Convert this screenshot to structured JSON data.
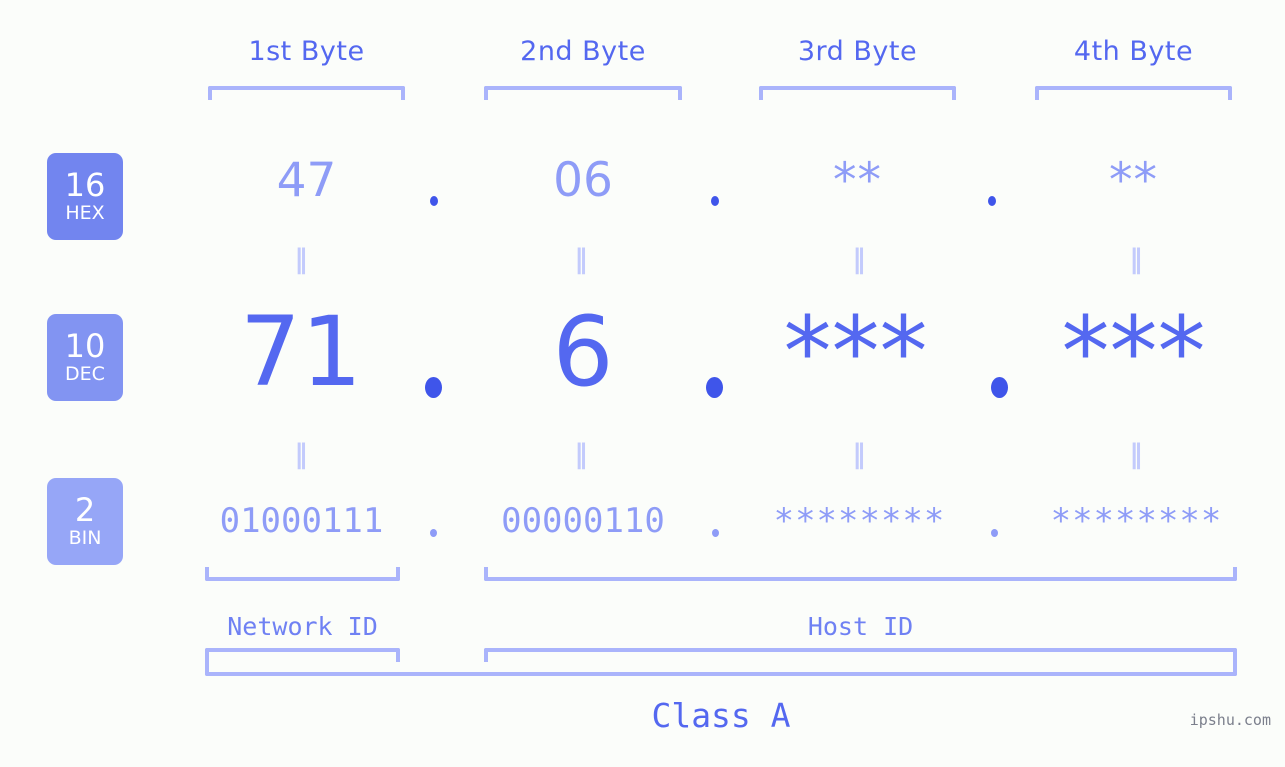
{
  "meta": {
    "background_color": "#fbfdfa",
    "accent_color": "#5468f0",
    "light_accent_color": "#aab4fb",
    "mid_accent_color": "#8e9cf7"
  },
  "byte_headers": [
    {
      "label": "1st Byte"
    },
    {
      "label": "2nd Byte"
    },
    {
      "label": "3rd Byte"
    },
    {
      "label": "4th Byte"
    }
  ],
  "radix_rows": [
    {
      "number": "16",
      "name": "HEX",
      "color": "#7285ef"
    },
    {
      "number": "10",
      "name": "DEC",
      "color": "#8294f2"
    },
    {
      "number": "2",
      "name": "BIN",
      "color": "#96a6f7"
    }
  ],
  "hex_row": {
    "values": [
      "47",
      "06",
      "**",
      "**"
    ],
    "separators": [
      ".",
      ".",
      "."
    ]
  },
  "dec_row": {
    "values": [
      "71",
      "6",
      "***",
      "***"
    ],
    "separators": [
      ".",
      ".",
      "."
    ]
  },
  "bin_row": {
    "values": [
      "01000111",
      "00000110",
      "********",
      "********"
    ],
    "separators": [
      ".",
      ".",
      "."
    ]
  },
  "equals_marks": {
    "symbol": "‖",
    "rows": 2,
    "columns": 4
  },
  "id_sections": [
    {
      "label": "Network ID"
    },
    {
      "label": "Host ID"
    }
  ],
  "class_section": {
    "label": "Class A"
  },
  "watermark": {
    "text": "ipshu.com"
  }
}
